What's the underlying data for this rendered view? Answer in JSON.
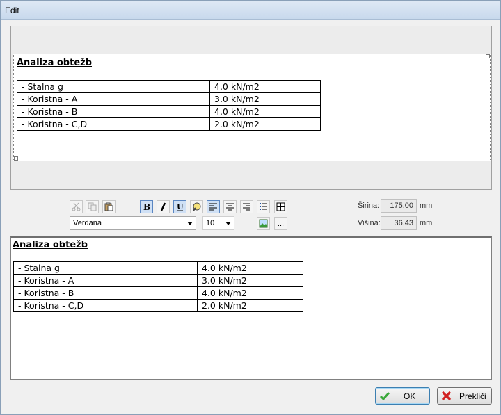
{
  "window": {
    "title": "Edit"
  },
  "document": {
    "title": "Analiza obtežb",
    "rows": [
      [
        "- Stalna g",
        "4.0 kN/m2"
      ],
      [
        "- Koristna - A",
        "3.0 kN/m2"
      ],
      [
        "- Koristna - B",
        "4.0 kN/m2"
      ],
      [
        "- Koristna - C,D",
        "2.0 kN/m2"
      ]
    ]
  },
  "toolbar": {
    "font_name": "Verdana",
    "font_size": "10",
    "more_label": "...",
    "icons": [
      "scissors-icon",
      "copy-icon",
      "paste-icon",
      "bold-icon",
      "italic-icon",
      "underline-icon",
      "highlight-icon",
      "align-left-icon",
      "align-center-icon",
      "align-right-icon",
      "bullet-list-icon",
      "table-icon",
      "image-icon"
    ]
  },
  "dimensions": {
    "width_label": "Širina:",
    "width_value": "175.00",
    "height_label": "Višina:",
    "height_value": "36.43",
    "unit": "mm"
  },
  "buttons": {
    "ok": "OK",
    "cancel": "Prekliči"
  },
  "colors": {
    "accent": "#5a86c2",
    "ok_icon": "#3aa83a",
    "cancel_icon": "#d12020"
  }
}
